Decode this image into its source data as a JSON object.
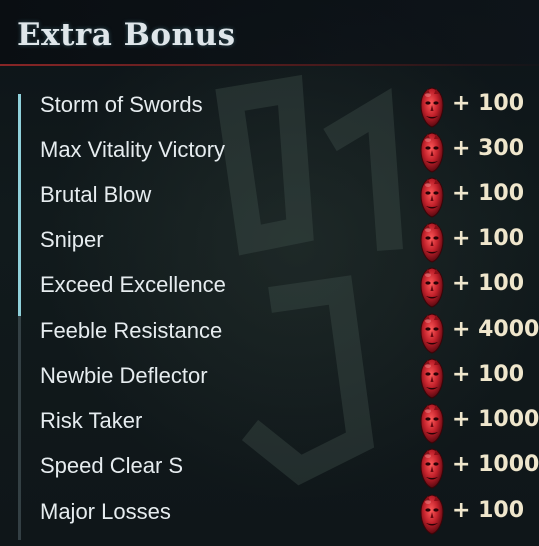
{
  "title": "Extra Bonus",
  "bonuses": [
    {
      "label": "Storm of Swords",
      "value": "+ 100"
    },
    {
      "label": "Max Vitality Victory",
      "value": "+ 300"
    },
    {
      "label": "Brutal Blow",
      "value": "+ 100"
    },
    {
      "label": "Sniper",
      "value": "+ 100"
    },
    {
      "label": "Exceed Excellence",
      "value": "+ 100"
    },
    {
      "label": "Feeble Resistance",
      "value": "+ 4000"
    },
    {
      "label": "Newbie Deflector",
      "value": "+ 100"
    },
    {
      "label": "Risk Taker",
      "value": "+ 1000"
    },
    {
      "label": "Speed Clear S",
      "value": "+ 1000"
    },
    {
      "label": "Major Losses",
      "value": "+ 100"
    }
  ],
  "icon": "red-orb-demon-face-icon",
  "scroll_position": 0.0,
  "colors": {
    "accent": "#8fd0da",
    "orb": "#c0202a",
    "value": "#efe6cc",
    "title_line": "#962828"
  }
}
